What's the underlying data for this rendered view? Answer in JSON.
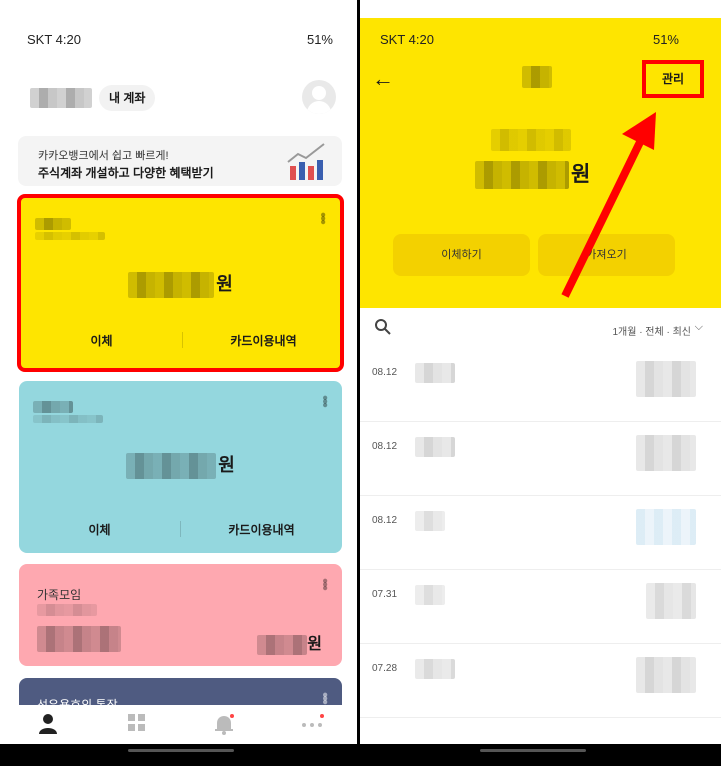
{
  "left": {
    "status": {
      "time": "SKT 4:20",
      "right": "51%"
    },
    "header": {
      "account_chip": "내 계좌"
    },
    "promo": {
      "line1": "카카오뱅크에서 쉽고 빠르게!",
      "line2": "주식계좌 개설하고 다양한 혜택받기"
    },
    "cards": [
      {
        "amount_unit": "원",
        "action1": "이체",
        "action2": "카드이용내역"
      },
      {
        "amount_unit": "원",
        "action1": "이체",
        "action2": "카드이용내역"
      },
      {
        "title": "가족모임",
        "amount_unit": "원"
      },
      {
        "title": "선우용호의 통장"
      }
    ],
    "nav": [
      "person-icon",
      "grid-icon",
      "bell-icon",
      "more-icon"
    ]
  },
  "right": {
    "status": {
      "time": "SKT 4:20",
      "right": "51%"
    },
    "manage_label": "관리",
    "amount_unit": "원",
    "buttons": {
      "transfer": "이체하기",
      "fetch": "가져오기"
    },
    "filter": "1개월 · 전체 · 최신",
    "rows": [
      {
        "date": "08.12"
      },
      {
        "date": "08.12"
      },
      {
        "date": "08.12"
      },
      {
        "date": "07.31"
      },
      {
        "date": "07.28"
      }
    ],
    "colors": {
      "yellow": "#fee500",
      "highlight": "#ff0000",
      "mint": "#94d7de",
      "pink": "#fea8b0",
      "navy": "#4f5b81"
    }
  }
}
